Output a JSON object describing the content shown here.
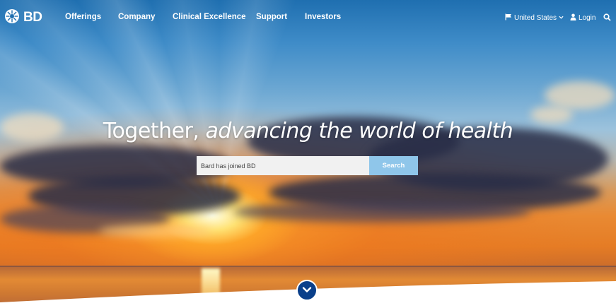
{
  "brand": {
    "logo_text": "BD"
  },
  "nav": {
    "items": [
      {
        "label": "Offerings"
      },
      {
        "label": "Company"
      },
      {
        "label": "Clinical Excellence"
      },
      {
        "label": "Support"
      },
      {
        "label": "Investors"
      }
    ],
    "region_label": "United States",
    "login_label": "Login"
  },
  "hero": {
    "headline_plain": "Together,",
    "headline_italic": "advancing the world of health"
  },
  "search": {
    "value": "Bard has joined BD",
    "button_label": "Search"
  },
  "icons": {
    "logo": "bd-sun-logo-icon",
    "region": "flag-icon",
    "region_dropdown": "chevron-down-icon",
    "login": "user-icon",
    "search": "search-icon",
    "scroll": "chevron-down-icon"
  },
  "colors": {
    "search_button": "#8fc6ea",
    "scroll_button": "#0a3f8a",
    "nav_text": "#ffffff"
  }
}
